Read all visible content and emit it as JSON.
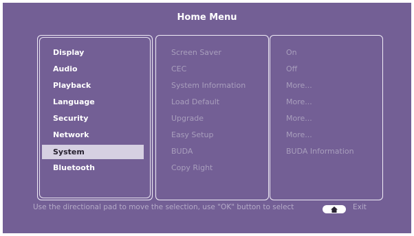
{
  "title": "Home Menu",
  "menu": {
    "items": [
      {
        "label": "Display",
        "selected": false
      },
      {
        "label": "Audio",
        "selected": false
      },
      {
        "label": "Playback",
        "selected": false
      },
      {
        "label": "Language",
        "selected": false
      },
      {
        "label": "Security",
        "selected": false
      },
      {
        "label": "Network",
        "selected": false
      },
      {
        "label": "System",
        "selected": true
      },
      {
        "label": "Bluetooth",
        "selected": false
      }
    ]
  },
  "submenu": {
    "items": [
      {
        "label": "Screen Saver",
        "value": "On"
      },
      {
        "label": "CEC",
        "value": "Off"
      },
      {
        "label": "System Information",
        "value": "More..."
      },
      {
        "label": "Load Default",
        "value": "More..."
      },
      {
        "label": "Upgrade",
        "value": "More..."
      },
      {
        "label": "Easy Setup",
        "value": "More..."
      },
      {
        "label": "BUDA",
        "value": "BUDA Information"
      },
      {
        "label": "Copy Right",
        "value": ""
      }
    ]
  },
  "footer": {
    "hint": "Use the directional pad to move the selection, use \"OK\" button to select",
    "home_icon": "home-icon",
    "exit_label": "Exit"
  },
  "colors": {
    "background": "#735f95",
    "selection": "#d6d0e2",
    "dim_text": "#a99fbd"
  }
}
